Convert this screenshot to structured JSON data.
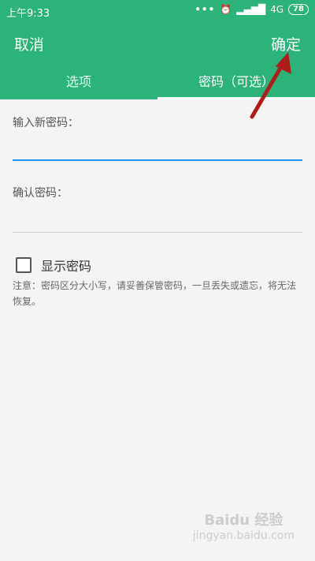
{
  "status": {
    "time": "上午9:33",
    "dots": "•••",
    "network": "4G",
    "battery": "78"
  },
  "appbar": {
    "cancel_label": "取消",
    "confirm_label": "确定"
  },
  "tabs": [
    {
      "label": "选项",
      "active": false
    },
    {
      "label": "密码（可选）",
      "active": true
    }
  ],
  "form": {
    "new_password_label": "输入新密码：",
    "new_password_value": "",
    "confirm_password_label": "确认密码：",
    "confirm_password_value": ""
  },
  "show_password": {
    "label": "显示密码",
    "checked": false
  },
  "note": "注意：密码区分大小写，请妥善保管密码，一旦丢失或遗忘，将无法恢复。",
  "watermark": {
    "brand": "Baidu 经验",
    "domain": "jingyan.baidu.com"
  },
  "colors": {
    "accent": "#2bb37a",
    "input_focus": "#2196f3",
    "arrow": "#b01c1c"
  },
  "icons": [
    "signal-icon",
    "alarm-icon",
    "battery-icon",
    "checkbox-icon"
  ]
}
